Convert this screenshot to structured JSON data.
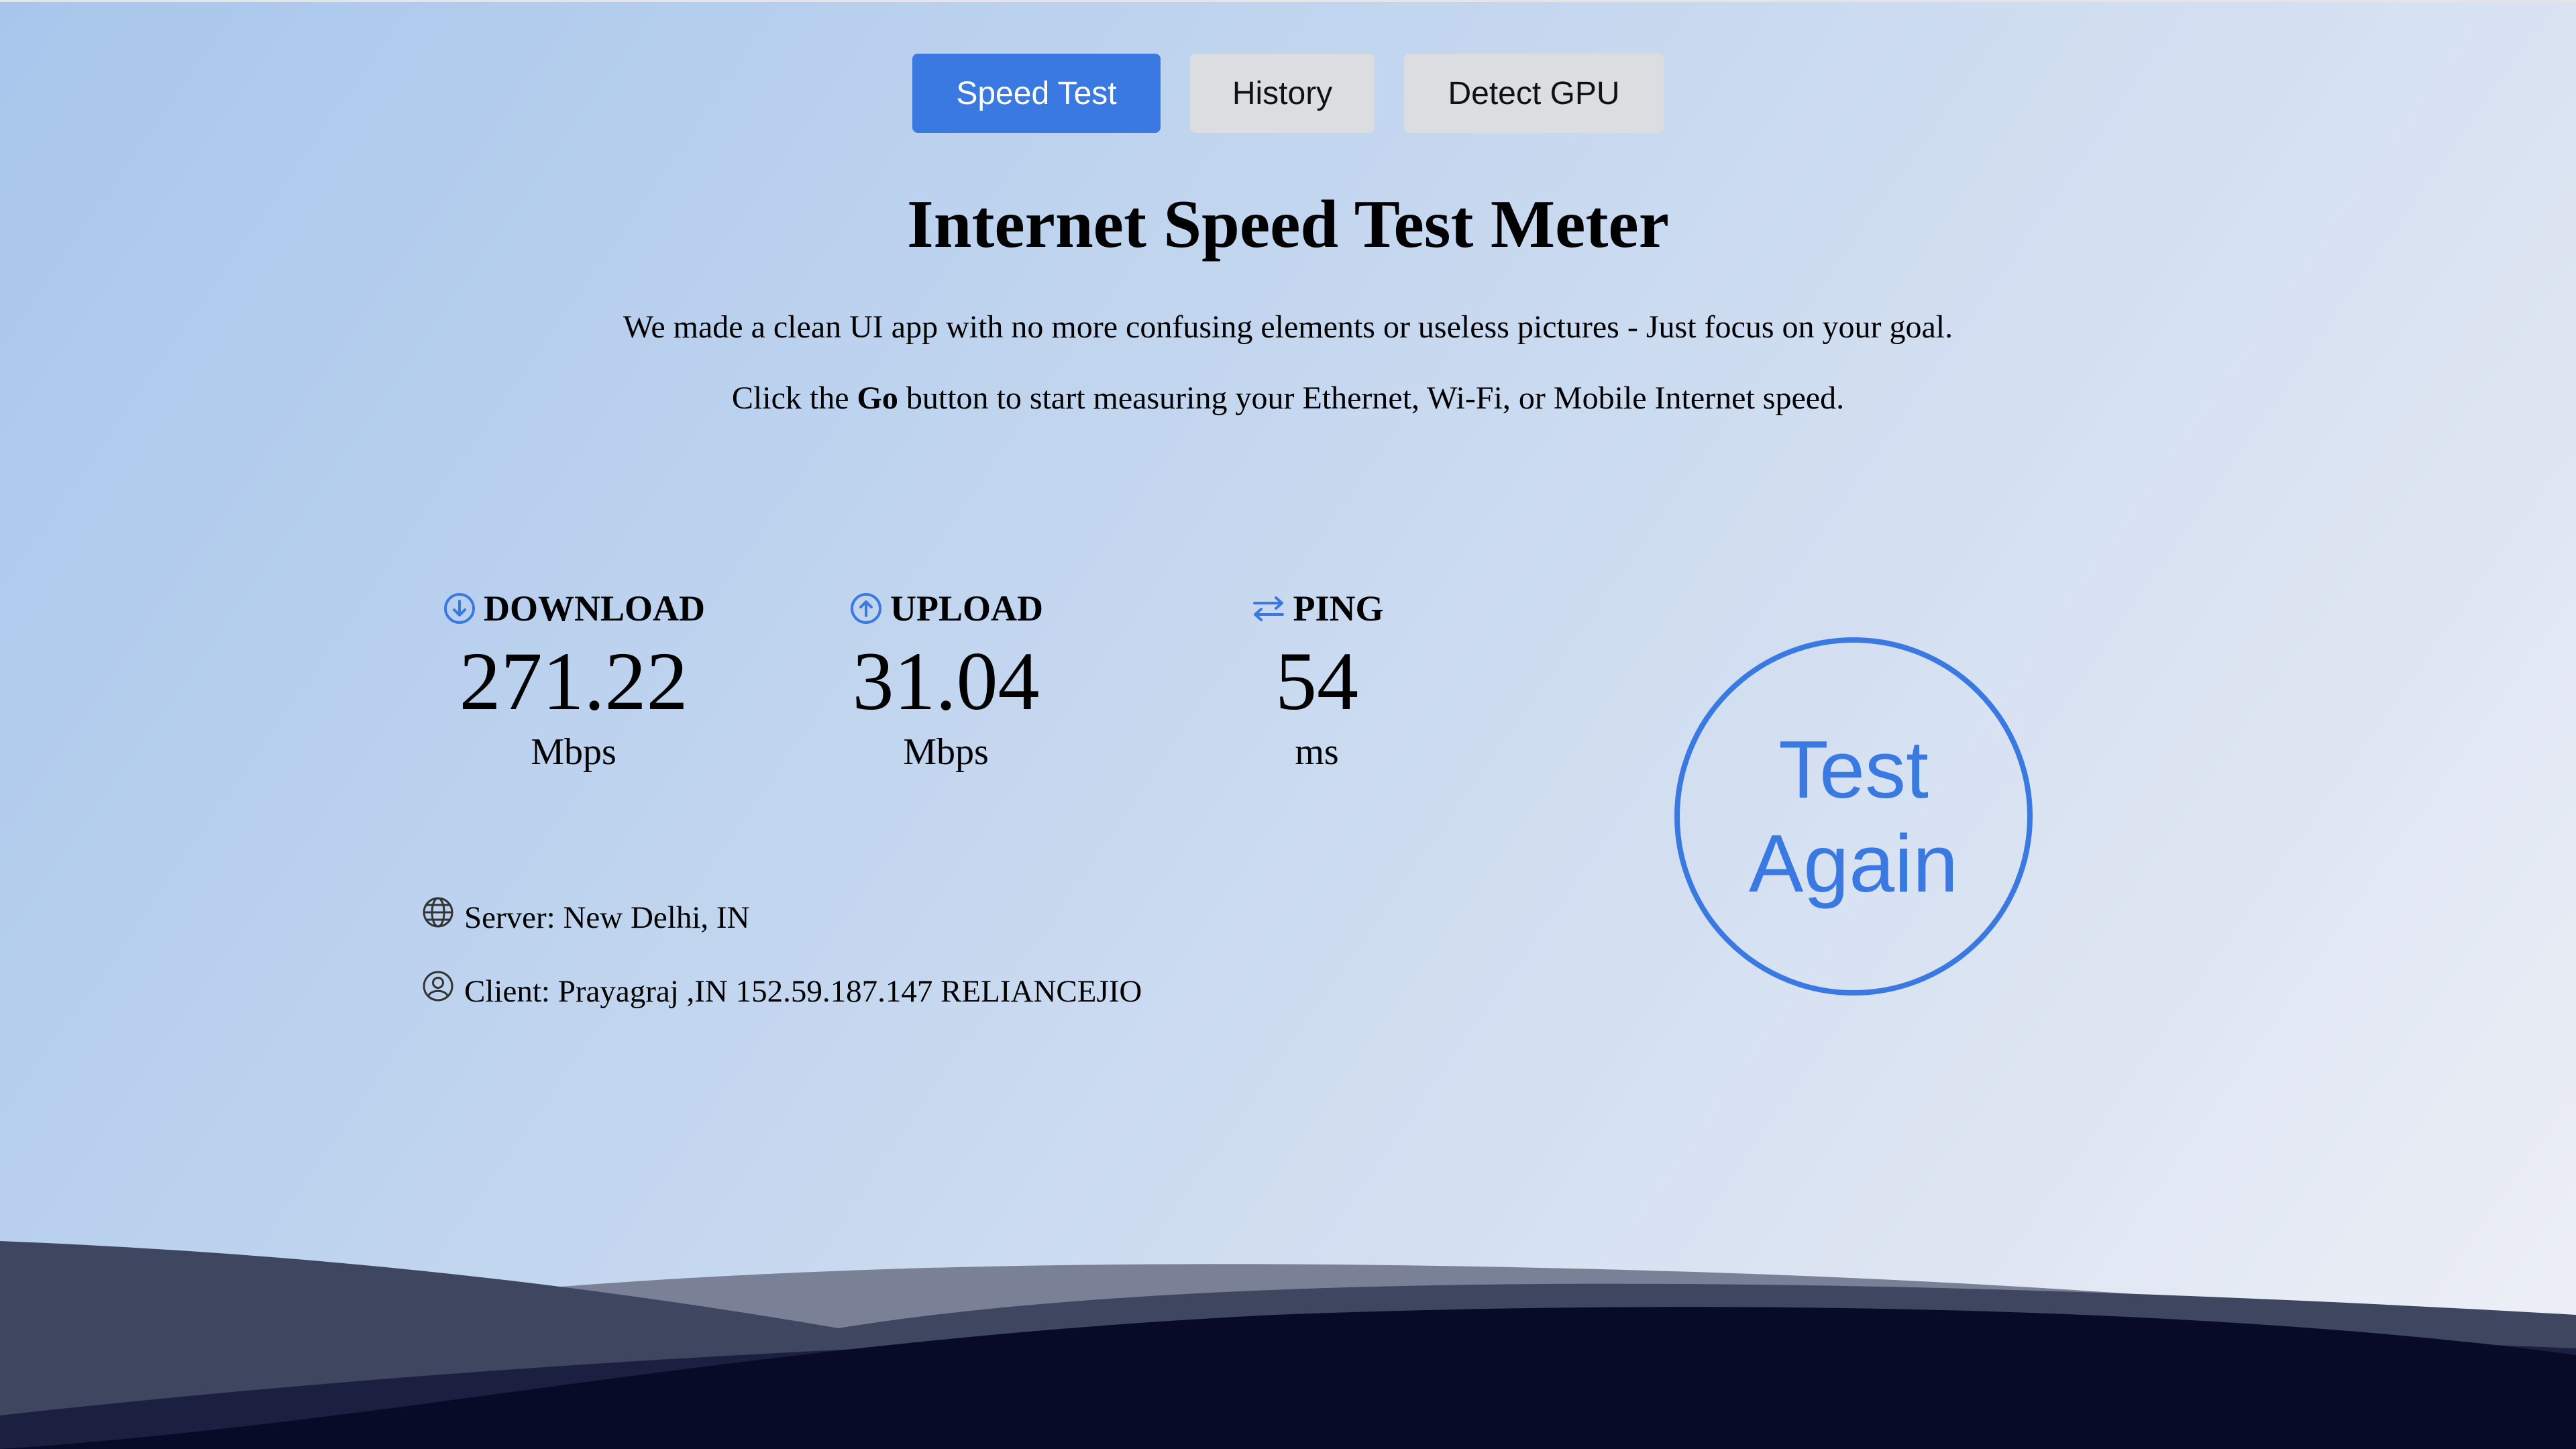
{
  "tabs": {
    "speed_test": "Speed Test",
    "history": "History",
    "detect_gpu": "Detect GPU",
    "active": "Speed Test"
  },
  "title": "Internet Speed Test Meter",
  "description": {
    "line1": "We made a clean UI app with no more confusing elements or useless pictures - Just focus on your goal.",
    "line2_prefix": "Click the ",
    "line2_bold": "Go",
    "line2_suffix": " button to start measuring your Ethernet, Wi-Fi, or Mobile Internet speed."
  },
  "metrics": {
    "download": {
      "label": "DOWNLOAD",
      "value": "271.22",
      "unit": "Mbps",
      "icon": "download-circle-icon"
    },
    "upload": {
      "label": "UPLOAD",
      "value": "31.04",
      "unit": "Mbps",
      "icon": "upload-circle-icon"
    },
    "ping": {
      "label": "PING",
      "value": "54",
      "unit": "ms",
      "icon": "swap-arrows-icon"
    }
  },
  "info": {
    "server": "Server: New Delhi, IN",
    "client": "Client: Prayagraj ,IN 152.59.187.147 RELIANCEJIO"
  },
  "action": {
    "label_line1": "Test",
    "label_line2": "Again"
  },
  "colors": {
    "accent": "#3a78e2",
    "tab_inactive": "#dcdde0",
    "wave_dark": "#070b28"
  }
}
